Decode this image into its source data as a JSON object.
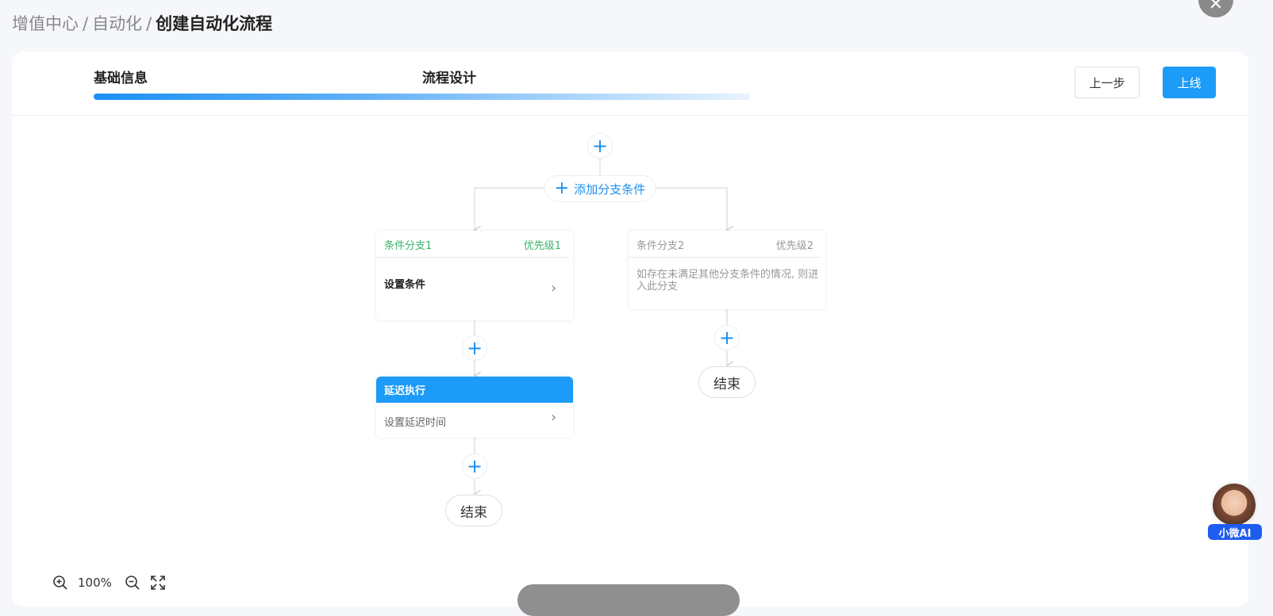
{
  "breadcrumb": {
    "items": [
      "增值中心",
      "自动化"
    ],
    "current": "创建自动化流程",
    "separator": "/"
  },
  "steps": {
    "step1": "基础信息",
    "step2": "流程设计"
  },
  "actions": {
    "prev_label": "上一步",
    "online_label": "上线"
  },
  "flow": {
    "plus_icon": "+",
    "add_branch_label": "添加分支条件",
    "branch1": {
      "name": "条件分支1",
      "priority": "优先级1",
      "set_condition": "设置条件",
      "color": "#3bb36a"
    },
    "branch2": {
      "name": "条件分支2",
      "priority": "优先级2",
      "description": "如存在未满足其他分支条件的情况, 则进入此分支",
      "color": "#999999"
    },
    "delay": {
      "title": "延迟执行",
      "setting": "设置延迟时间"
    },
    "end_label": "结束"
  },
  "zoom": {
    "level": "100%"
  },
  "ai_assistant": {
    "label": "小微AI"
  },
  "colors": {
    "primary": "#1c9bf8",
    "link": "#1c8ff0"
  }
}
